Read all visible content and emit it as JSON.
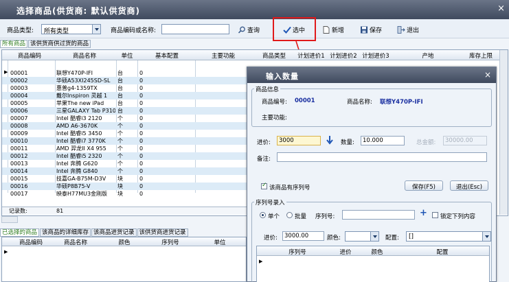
{
  "window": {
    "title": "选择商品(供货商: 默认供货商)",
    "close": "×"
  },
  "toolbar": {
    "category_label": "商品类型:",
    "category_value": "所有类型",
    "code_label": "商品编码或名称:",
    "code_value": "",
    "query": "查询",
    "select": "选中",
    "add": "新增",
    "save": "保存",
    "exit": "退出"
  },
  "top_tabs": [
    "所有商品",
    "该供货商供过货的商品"
  ],
  "grid": {
    "columns": [
      "商品编码",
      "商品名称",
      "单位",
      "基本配置",
      "主要功能",
      "商品类型",
      "计划进价1",
      "计划进价2",
      "计划进价3",
      "产地",
      "库存上限"
    ],
    "rows": [
      [
        "00001",
        "联想Y470P-IFI",
        "台",
        "0"
      ],
      [
        "00002",
        "华硕A53XI245SD-SL",
        "台",
        "0"
      ],
      [
        "00003",
        "惠普g4-1359TX",
        "台",
        "0"
      ],
      [
        "00004",
        "戴尔Inspiron 灵越 1",
        "台",
        "0"
      ],
      [
        "00005",
        "苹果The new iPad",
        "台",
        "0"
      ],
      [
        "00006",
        "三星GALAXY Tab P310",
        "台",
        "0"
      ],
      [
        "00007",
        "Intel 酷睿i3 2120",
        "个",
        "0"
      ],
      [
        "00008",
        "AMD A6-3670K",
        "个",
        "0"
      ],
      [
        "00009",
        "Intel 酷睿i5 3450",
        "个",
        "0"
      ],
      [
        "00010",
        "Intel 酷睿i7 3770K",
        "个",
        "0"
      ],
      [
        "00011",
        "AMD 羿龙II X4 955",
        "个",
        "0"
      ],
      [
        "00012",
        "Intel 酷睿i5 2320",
        "个",
        "0"
      ],
      [
        "00013",
        "Intel 奔腾 G620",
        "个",
        "0"
      ],
      [
        "00014",
        "Intel 奔腾 G840",
        "个",
        "0"
      ],
      [
        "00015",
        "技嘉GA-B75M-D3V",
        "块",
        "0"
      ],
      [
        "00016",
        "华硕P8B75-V",
        "块",
        "0"
      ],
      [
        "00017",
        "映泰H77MU3金刚版",
        "块",
        "0"
      ]
    ],
    "count_label": "记录数:",
    "count_value": "81"
  },
  "bottom_tabs": [
    "已选择的商品",
    "该商品的详细库存",
    "该商品进货记录",
    "该供货商进货记录"
  ],
  "bottom_grid": {
    "columns": [
      "商品编码",
      "商品名称",
      "颜色",
      "序列号",
      "单位"
    ]
  },
  "dialog": {
    "title": "输入数量",
    "close": "×",
    "info_group": "商品信息",
    "code_label": "商品编号:",
    "code_value": "00001",
    "name_label": "商品名称:",
    "name_value": "联想Y470P-IFI",
    "function_label": "主要功能:",
    "price_label": "进价:",
    "price_value": "3000",
    "qty_label": "数量:",
    "qty_value": "10.000",
    "total_label": "总金额:",
    "total_value": "30000.00",
    "note_label": "备注:",
    "note_value": "",
    "serial_check": "该商品有序列号",
    "save_button": "保存(F5)",
    "exit_button": "退出(Esc)",
    "serial_group": "序列号录入",
    "single": "单个",
    "batch": "批量",
    "serial_label": "序列号:",
    "serial_value": "",
    "lock_label": "锁定下列内容",
    "price2_label": "进价:",
    "price2_value": "3000.00",
    "color_label": "颜色:",
    "color_value": "",
    "config_label": "配置:",
    "config_value": "[]",
    "serial_columns": [
      "序列号",
      "进价",
      "颜色",
      "配置"
    ]
  },
  "colors": {
    "title_bar": "#4a5468",
    "highlight_box": "#e0191a",
    "row_alt": "#dcebf7",
    "value_blue": "#1a2fa0"
  }
}
